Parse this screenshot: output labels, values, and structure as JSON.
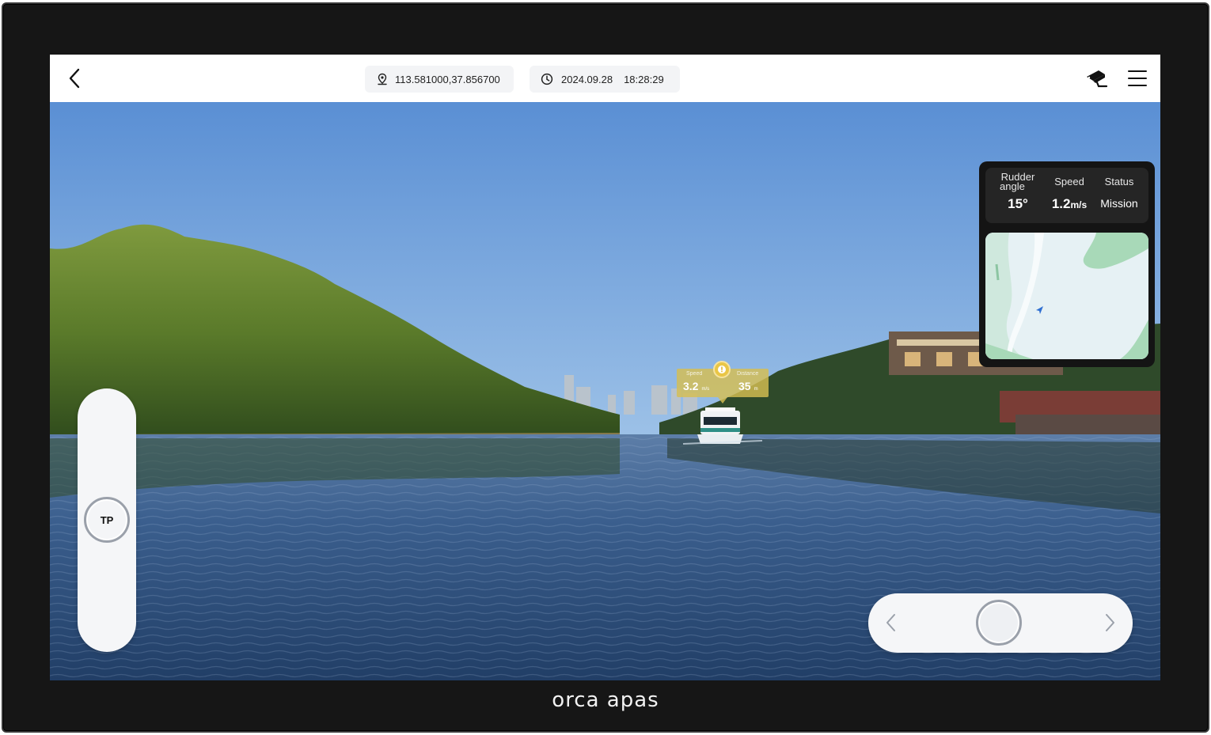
{
  "topbar": {
    "back_icon": "chevron-left-icon",
    "location": "113.581000,37.856700",
    "date": "2024.09.28",
    "time": "18:28:29",
    "camera_icon": "camera-icon",
    "menu_icon": "hamburger-menu-icon"
  },
  "target": {
    "speed_label": "Speed",
    "speed_value": "3.2",
    "speed_unit": "m/s",
    "distance_label": "Distance",
    "distance_value": "35",
    "distance_unit": "m"
  },
  "telemetry": {
    "rudder_label_line1": "Rudder",
    "rudder_label_line2": "angle",
    "rudder_value": "15°",
    "speed_label": "Speed",
    "speed_value": "1.2",
    "speed_unit": "m/s",
    "status_label": "Status",
    "status_value": "Mission"
  },
  "controls": {
    "throttle_label": "TP"
  },
  "brand": "orca apas",
  "colors": {
    "sky_top": "#5a8fd4",
    "sky_bottom": "#bcd6ea",
    "water": "#2c4a73",
    "marker": "#d6be52"
  }
}
